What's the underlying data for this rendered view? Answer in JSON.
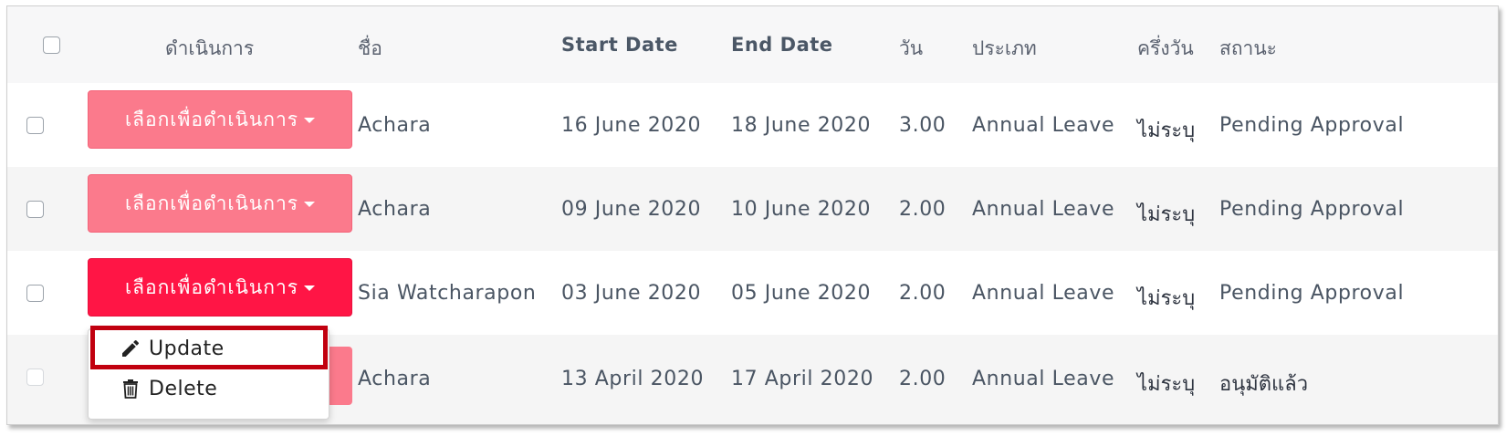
{
  "table": {
    "headers": {
      "select_all": "",
      "action": "ดำเนินการ",
      "name": "ชื่อ",
      "start_date": "Start Date",
      "end_date": "End Date",
      "days": "วัน",
      "type": "ประเภท",
      "half_day": "ครึ่งวัน",
      "status": "สถานะ"
    },
    "rows": [
      {
        "action_label": "เลือกเพื่อดำเนินการ",
        "name": "Achara",
        "start_date": "16 June 2020",
        "end_date": "18 June 2020",
        "days": "3.00",
        "type": "Annual Leave",
        "half_day": "ไม่ระบุ",
        "status": "Pending Approval"
      },
      {
        "action_label": "เลือกเพื่อดำเนินการ",
        "name": "Achara",
        "start_date": "09 June 2020",
        "end_date": "10 June 2020",
        "days": "2.00",
        "type": "Annual Leave",
        "half_day": "ไม่ระบุ",
        "status": "Pending Approval"
      },
      {
        "action_label": "เลือกเพื่อดำเนินการ",
        "name": "Sia Watcharapon",
        "start_date": "03 June 2020",
        "end_date": "05 June 2020",
        "days": "2.00",
        "type": "Annual Leave",
        "half_day": "ไม่ระบุ",
        "status": "Pending Approval"
      },
      {
        "action_label": "",
        "name": "Achara",
        "start_date": "13 April 2020",
        "end_date": "17 April 2020",
        "days": "2.00",
        "type": "Annual Leave",
        "half_day": "ไม่ระบุ",
        "status": "อนุมัติแล้ว"
      }
    ]
  },
  "dropdown_menu": {
    "items": [
      {
        "label": "Update",
        "icon": "pencil-icon"
      },
      {
        "label": "Delete",
        "icon": "trash-icon"
      }
    ]
  },
  "colors": {
    "action_button": "#fb7a8c",
    "action_button_active": "#ff1545",
    "highlight_box": "#c1000f"
  }
}
